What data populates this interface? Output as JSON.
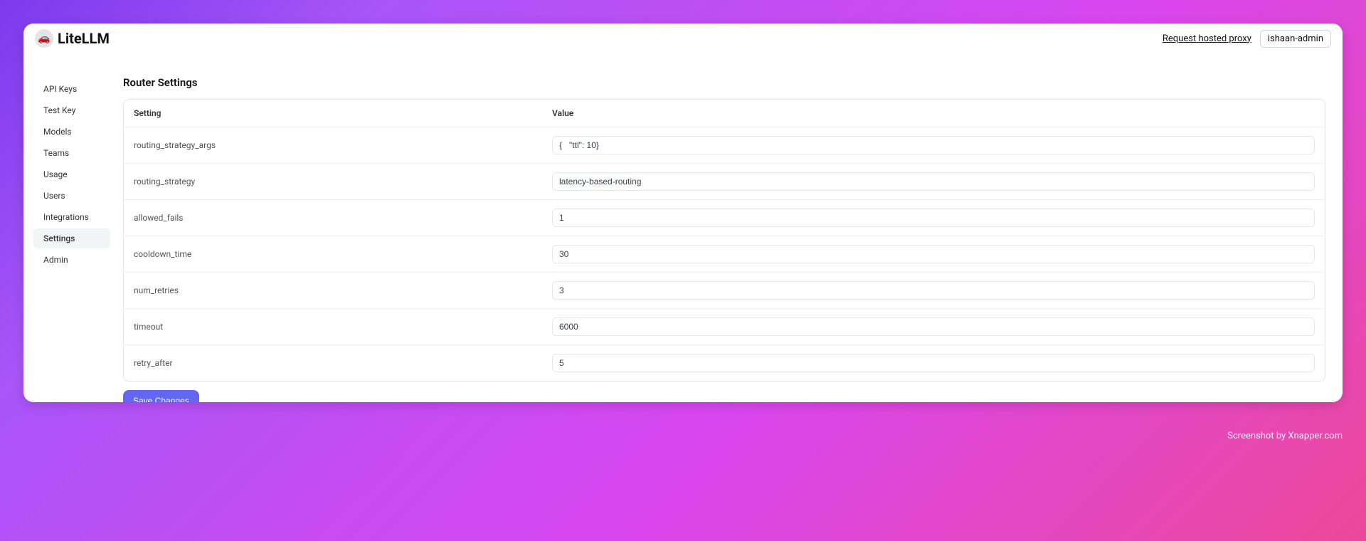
{
  "brand": {
    "name": "LiteLLM",
    "icon_emoji": "🚗"
  },
  "topbar": {
    "hosted_link": "Request hosted proxy",
    "user": "ishaan-admin"
  },
  "sidebar": {
    "items": [
      {
        "label": "API Keys",
        "active": false
      },
      {
        "label": "Test Key",
        "active": false
      },
      {
        "label": "Models",
        "active": false
      },
      {
        "label": "Teams",
        "active": false
      },
      {
        "label": "Usage",
        "active": false
      },
      {
        "label": "Users",
        "active": false
      },
      {
        "label": "Integrations",
        "active": false
      },
      {
        "label": "Settings",
        "active": true
      },
      {
        "label": "Admin",
        "active": false
      }
    ]
  },
  "page": {
    "title": "Router Settings",
    "columns": {
      "setting": "Setting",
      "value": "Value"
    },
    "save_button": "Save Changes"
  },
  "settings": [
    {
      "key": "routing_strategy_args",
      "value": "{   \"ttl\": 10}"
    },
    {
      "key": "routing_strategy",
      "value": "latency-based-routing"
    },
    {
      "key": "allowed_fails",
      "value": "1"
    },
    {
      "key": "cooldown_time",
      "value": "30"
    },
    {
      "key": "num_retries",
      "value": "3"
    },
    {
      "key": "timeout",
      "value": "6000"
    },
    {
      "key": "retry_after",
      "value": "5"
    }
  ],
  "watermark": "Screenshot by Xnapper.com"
}
